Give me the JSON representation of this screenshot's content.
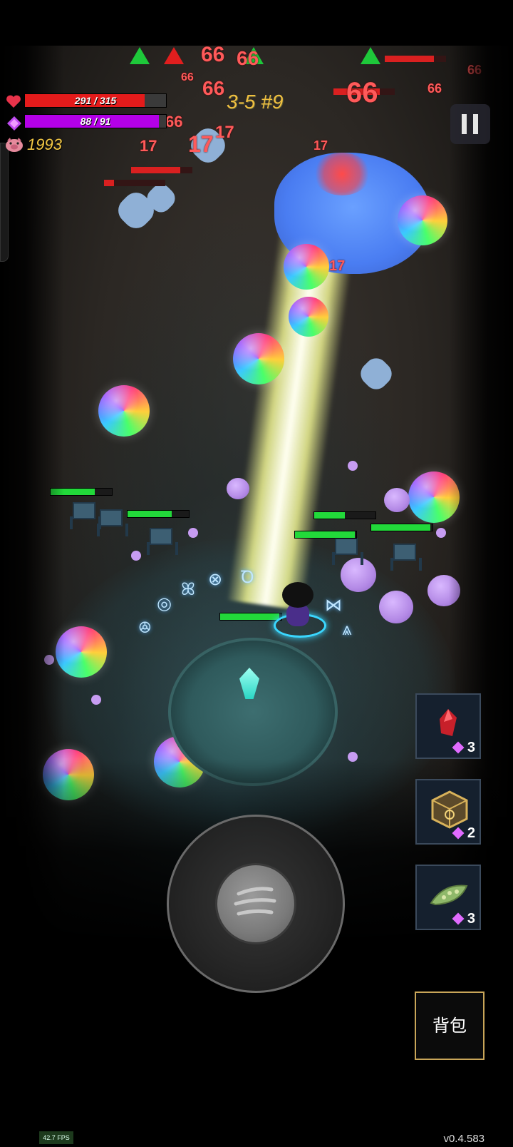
{
  "hud": {
    "hp_text": "291 / 315",
    "hp_fraction": 0.924,
    "mp_text": "88 / 91",
    "mp_fraction": 0.967,
    "coins": "1993",
    "stage": "3-5 #9",
    "colors": {
      "hp": "#e41b1b",
      "mp": "#b400e8",
      "coins": "#f2c744",
      "stage": "#f0c040"
    }
  },
  "items": [
    {
      "icon": "red-crystal-icon",
      "count": "3"
    },
    {
      "icon": "golden-cube-icon",
      "count": "2"
    },
    {
      "icon": "green-leaf-icon",
      "count": "3"
    }
  ],
  "damage_numbers": [
    "66",
    "66",
    "66",
    "66",
    "66",
    "66",
    "66",
    "66",
    "17",
    "17",
    "17",
    "17",
    "17"
  ],
  "bag_label": "背包",
  "fps": "42.7 FPS",
  "version": "v0.4.583"
}
